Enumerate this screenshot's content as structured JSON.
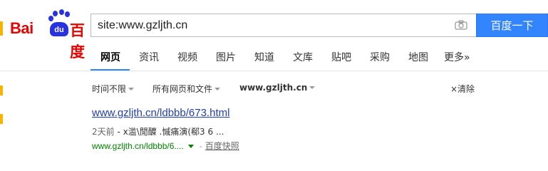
{
  "logo": {
    "bai": "Bai",
    "du": "du",
    "cn": "百度"
  },
  "search": {
    "query": "site:www.gzljth.cn",
    "button_label": "百度一下"
  },
  "nav": {
    "items": [
      "网页",
      "资讯",
      "视频",
      "图片",
      "知道",
      "文库",
      "贴吧",
      "采购",
      "地图",
      "更多»"
    ]
  },
  "filters": {
    "time": "时间不限",
    "type": "所有网页和文件",
    "site": "www.gzljth.cn",
    "clear": "×清除"
  },
  "result": {
    "title": "www.gzljth.cn/ldbbb/673.html",
    "date": "2天前",
    "snippet_text": " - x滥\\閒醾  .慽痛演(郗3 6 ...",
    "url": "www.gzljth.cn/ldbbb/6....",
    "snapshot": "百度快照"
  },
  "colors": {
    "accent": "#3385ff",
    "link": "#2440b3",
    "url_green": "#008000",
    "logo_red": "#e10601",
    "logo_blue": "#2932e1"
  }
}
